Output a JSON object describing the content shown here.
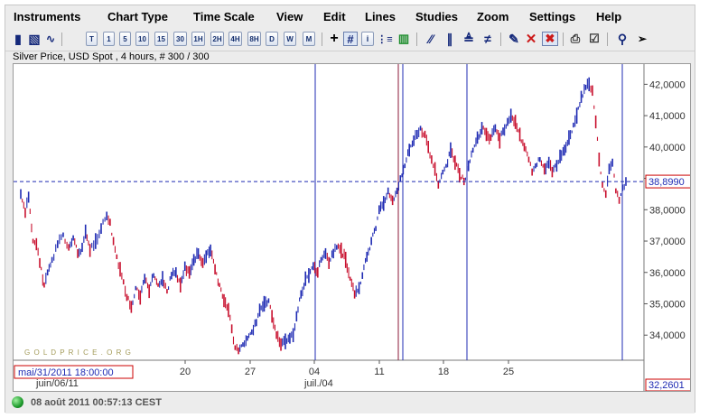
{
  "menu": [
    "Instruments",
    "Chart Type",
    "Time Scale",
    "View",
    "Edit",
    "Lines",
    "Studies",
    "Zoom",
    "Settings",
    "Help"
  ],
  "toolbar": {
    "timeframes": [
      "T",
      "1",
      "5",
      "10",
      "15",
      "30",
      "1H",
      "2H",
      "4H",
      "8H",
      "D",
      "W",
      "M"
    ]
  },
  "info_line": "Silver Price, USD Spot , 4 hours, # 300 / 300",
  "watermark": "G O L D P R I C E . O R G",
  "status": {
    "text": "08 août 2011 00:57:13 CEST",
    "color": "#1f9b2d"
  },
  "cursor": {
    "date_label": "mai/31/2011 18:00:00",
    "price_label": "38,8990",
    "bottom_label": "32,2601",
    "color": "#cc0000"
  },
  "chart_data": {
    "type": "candlestick",
    "title": "Silver Price, USD Spot , 4 hours",
    "unit": "USD",
    "y_ticks": [
      "42,0000",
      "41,0000",
      "40,0000",
      "39,0000",
      "38,0000",
      "37,0000",
      "36,0000",
      "35,0000",
      "34,0000"
    ],
    "y_tick_values": [
      42,
      41,
      40,
      39,
      38,
      37,
      36,
      35,
      34
    ],
    "ylim": [
      33.2,
      42.5
    ],
    "x_tick_labels": [
      "20",
      "27",
      "04",
      "11",
      "18",
      "25"
    ],
    "x_sub_labels": [
      "juin/06/11",
      "juil./04"
    ],
    "series": [
      {
        "name": "Silver Price",
        "path": [
          [
            0,
            38.5
          ],
          [
            4,
            37.9
          ],
          [
            7,
            38.4
          ],
          [
            11,
            37.0
          ],
          [
            14,
            36.9
          ],
          [
            17,
            36.3
          ],
          [
            21,
            35.6
          ],
          [
            24,
            36.0
          ],
          [
            28,
            36.4
          ],
          [
            33,
            36.9
          ],
          [
            38,
            37.2
          ],
          [
            43,
            36.8
          ],
          [
            47,
            37.1
          ],
          [
            51,
            36.6
          ],
          [
            55,
            36.8
          ],
          [
            58,
            37.3
          ],
          [
            62,
            36.7
          ],
          [
            67,
            37.0
          ],
          [
            72,
            37.4
          ],
          [
            77,
            37.8
          ],
          [
            80,
            37.6
          ],
          [
            83,
            37.0
          ],
          [
            86,
            36.5
          ],
          [
            89,
            36.1
          ],
          [
            92,
            35.7
          ],
          [
            95,
            35.2
          ],
          [
            99,
            34.9
          ],
          [
            103,
            35.5
          ],
          [
            107,
            35.2
          ],
          [
            111,
            35.8
          ],
          [
            115,
            35.4
          ],
          [
            119,
            35.9
          ],
          [
            123,
            35.6
          ],
          [
            127,
            35.8
          ],
          [
            131,
            35.4
          ],
          [
            135,
            35.9
          ],
          [
            139,
            36.0
          ],
          [
            143,
            35.6
          ],
          [
            147,
            36.2
          ],
          [
            151,
            36.0
          ],
          [
            155,
            36.4
          ],
          [
            159,
            36.6
          ],
          [
            163,
            36.3
          ],
          [
            166,
            36.5
          ],
          [
            170,
            36.7
          ],
          [
            174,
            36.1
          ],
          [
            178,
            35.6
          ],
          [
            182,
            35.1
          ],
          [
            186,
            34.8
          ],
          [
            189,
            34.2
          ],
          [
            192,
            33.6
          ],
          [
            195,
            33.5
          ],
          [
            199,
            33.7
          ],
          [
            203,
            33.9
          ],
          [
            207,
            34.1
          ],
          [
            211,
            34.4
          ],
          [
            214,
            34.8
          ],
          [
            218,
            35.0
          ],
          [
            222,
            35.1
          ],
          [
            225,
            34.6
          ],
          [
            229,
            34.0
          ],
          [
            233,
            33.7
          ],
          [
            237,
            33.8
          ],
          [
            241,
            33.9
          ],
          [
            244,
            34.0
          ],
          [
            247,
            34.6
          ],
          [
            251,
            35.3
          ],
          [
            255,
            35.8
          ],
          [
            258,
            35.9
          ],
          [
            262,
            36.2
          ],
          [
            266,
            36.0
          ],
          [
            269,
            36.4
          ],
          [
            273,
            36.6
          ],
          [
            276,
            36.3
          ],
          [
            280,
            36.6
          ],
          [
            283,
            36.8
          ],
          [
            287,
            36.7
          ],
          [
            291,
            36.4
          ],
          [
            295,
            35.8
          ],
          [
            299,
            35.3
          ],
          [
            303,
            35.5
          ],
          [
            306,
            35.9
          ],
          [
            310,
            36.5
          ],
          [
            314,
            37.0
          ],
          [
            318,
            37.4
          ],
          [
            321,
            38.0
          ],
          [
            325,
            38.2
          ],
          [
            329,
            38.6
          ],
          [
            333,
            38.3
          ],
          [
            337,
            38.6
          ],
          [
            340,
            39.0
          ],
          [
            344,
            39.4
          ],
          [
            348,
            39.9
          ],
          [
            352,
            40.2
          ],
          [
            355,
            40.4
          ],
          [
            358,
            40.6
          ],
          [
            362,
            40.4
          ],
          [
            365,
            40.0
          ],
          [
            368,
            39.6
          ],
          [
            371,
            39.3
          ],
          [
            374,
            38.8
          ],
          [
            378,
            39.2
          ],
          [
            381,
            39.4
          ],
          [
            385,
            39.9
          ],
          [
            389,
            39.5
          ],
          [
            393,
            39.1
          ],
          [
            397,
            38.9
          ],
          [
            401,
            39.4
          ],
          [
            405,
            39.9
          ],
          [
            409,
            40.3
          ],
          [
            413,
            40.6
          ],
          [
            417,
            40.4
          ],
          [
            421,
            40.3
          ],
          [
            425,
            40.6
          ],
          [
            429,
            40.2
          ],
          [
            432,
            40.5
          ],
          [
            436,
            40.8
          ],
          [
            439,
            41.0
          ],
          [
            443,
            40.8
          ],
          [
            447,
            40.4
          ],
          [
            451,
            40.0
          ],
          [
            455,
            39.6
          ],
          [
            458,
            39.2
          ],
          [
            461,
            39.4
          ],
          [
            465,
            39.6
          ],
          [
            469,
            39.3
          ],
          [
            473,
            39.5
          ],
          [
            476,
            39.2
          ],
          [
            480,
            39.4
          ],
          [
            483,
            39.7
          ],
          [
            487,
            39.9
          ],
          [
            491,
            40.3
          ],
          [
            495,
            40.7
          ],
          [
            498,
            41.0
          ],
          [
            502,
            41.6
          ],
          [
            506,
            41.9
          ],
          [
            509,
            42.0
          ],
          [
            512,
            41.8
          ],
          [
            515,
            40.8
          ],
          [
            518,
            39.6
          ],
          [
            521,
            38.8
          ],
          [
            524,
            38.5
          ],
          [
            527,
            39.3
          ],
          [
            530,
            39.5
          ],
          [
            533,
            38.6
          ],
          [
            536,
            38.3
          ],
          [
            539,
            38.7
          ],
          [
            542,
            38.9
          ]
        ]
      }
    ],
    "x_range": [
      0,
      542
    ],
    "grid": false,
    "crosshair_price": 38.899,
    "blue_vertical_lines_count": 5
  }
}
